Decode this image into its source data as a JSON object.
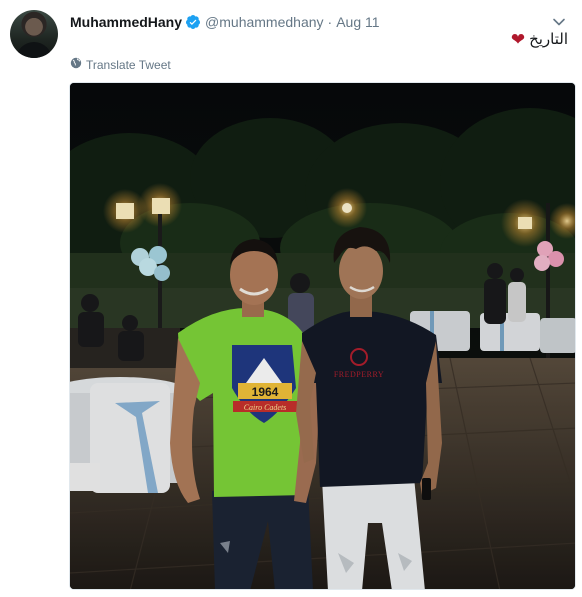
{
  "tweet": {
    "display_name": "MuhammedHany",
    "handle": "@muhammedhany",
    "separator": "·",
    "date": "Aug 11",
    "text": "التاريخ",
    "translate_label": "Translate Tweet"
  },
  "icons": {
    "verified": "verified-badge-icon",
    "caret": "chevron-down-icon",
    "globe": "globe-icon",
    "heart": "heart-emoji"
  },
  "colors": {
    "verified_blue": "#1da1f2",
    "secondary_text": "#657786",
    "heart_red": "#b0182c",
    "green_shirt": "#7fd63a",
    "black_shirt": "#141a26"
  },
  "photo": {
    "shirt_badge_text": "1964",
    "shirt_badge_subtext": "Cairo Cadets",
    "shirt_brand_text": "FREDPERRY"
  }
}
